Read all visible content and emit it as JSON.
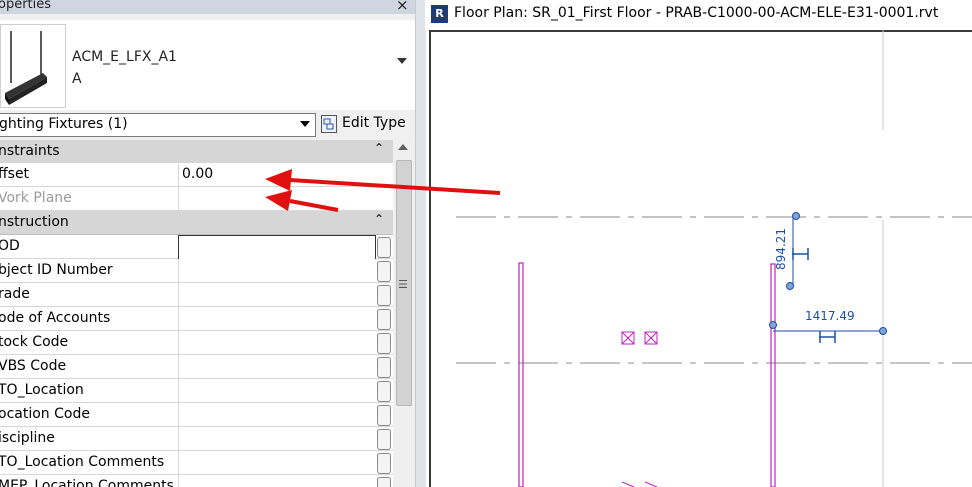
{
  "panel": {
    "title": "operties",
    "close_glyph": "×"
  },
  "type_selector": {
    "family_line1": "ACM_E_LFX_A1",
    "family_line2": "A",
    "thumbnail_icon": "light-fixture-thumbnail"
  },
  "category_dropdown": {
    "value": "ghting Fixtures (1)"
  },
  "edit_type": {
    "label": "Edit Type",
    "icon": "edit-type-icon"
  },
  "groups": {
    "constraints": {
      "label": "nstraints",
      "toggle": "⌃"
    },
    "construction": {
      "label": "nstruction",
      "toggle": "⌃"
    }
  },
  "rows": {
    "offset": {
      "name": "ffset",
      "value": "0.00"
    },
    "work_plane": {
      "name": "Vork Plane",
      "value": ""
    },
    "cod": {
      "name": "OD",
      "value": ""
    },
    "object_id": {
      "name": "bject ID Number",
      "value": ""
    },
    "trade": {
      "name": "rade",
      "value": ""
    },
    "code_accounts": {
      "name": "ode of Accounts",
      "value": ""
    },
    "stock_code": {
      "name": "tock Code",
      "value": ""
    },
    "wbs_code": {
      "name": "VBS Code",
      "value": ""
    },
    "ato_location": {
      "name": "TO_Location",
      "value": ""
    },
    "location_code": {
      "name": "ocation Code",
      "value": ""
    },
    "discipline": {
      "name": "iscipline",
      "value": ""
    },
    "ato_location_comments": {
      "name": "TO_Location Comments",
      "value": ""
    },
    "mep_location_comments": {
      "name": "MEP_Location Comments",
      "value": ""
    }
  },
  "view": {
    "title": "Floor Plan: SR_01_First Floor - PRAB-C1000-00-ACM-ELE-E31-0001.rvt",
    "icon_text": "R",
    "dim_vertical": "894.21",
    "dim_horizontal": "1417.49"
  },
  "colors": {
    "annotation_arrow": "#e01010",
    "fixture_magenta": "#c020c0",
    "dimension_blue": "#1f4fa0"
  }
}
